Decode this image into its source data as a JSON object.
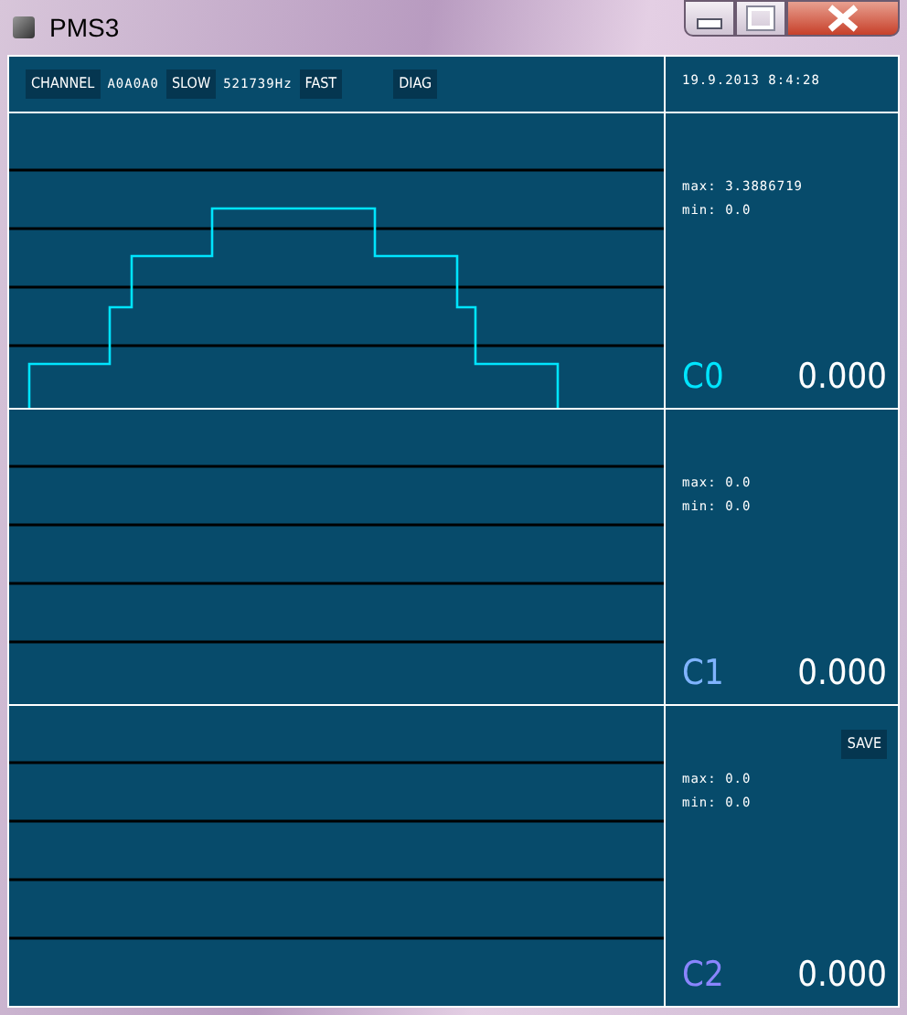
{
  "window": {
    "title": "PMS3"
  },
  "toolbar": [
    {
      "kind": "button",
      "label": "CHANNEL"
    },
    {
      "kind": "text",
      "label": "A0A0A0"
    },
    {
      "kind": "button",
      "label": "SLOW"
    },
    {
      "kind": "text",
      "label": "521739Hz"
    },
    {
      "kind": "button",
      "label": "FAST"
    },
    {
      "kind": "gap"
    },
    {
      "kind": "button",
      "label": "DIAG"
    }
  ],
  "datetime": "19.9.2013 8:4:28",
  "channels": [
    {
      "name": "C0",
      "color": "#00e5ff",
      "max": "max: 3.3886719",
      "min": "min: 0.0",
      "value": "0.000",
      "trace": true
    },
    {
      "name": "C1",
      "color": "#80b4ff",
      "max": "max: 0.0",
      "min": "min: 0.0",
      "value": "0.000",
      "trace": false
    },
    {
      "name": "C2",
      "color": "#8a85ff",
      "max": "max: 0.0",
      "min": "min: 0.0",
      "value": "0.000",
      "trace": false,
      "button": "SAVE"
    }
  ]
}
